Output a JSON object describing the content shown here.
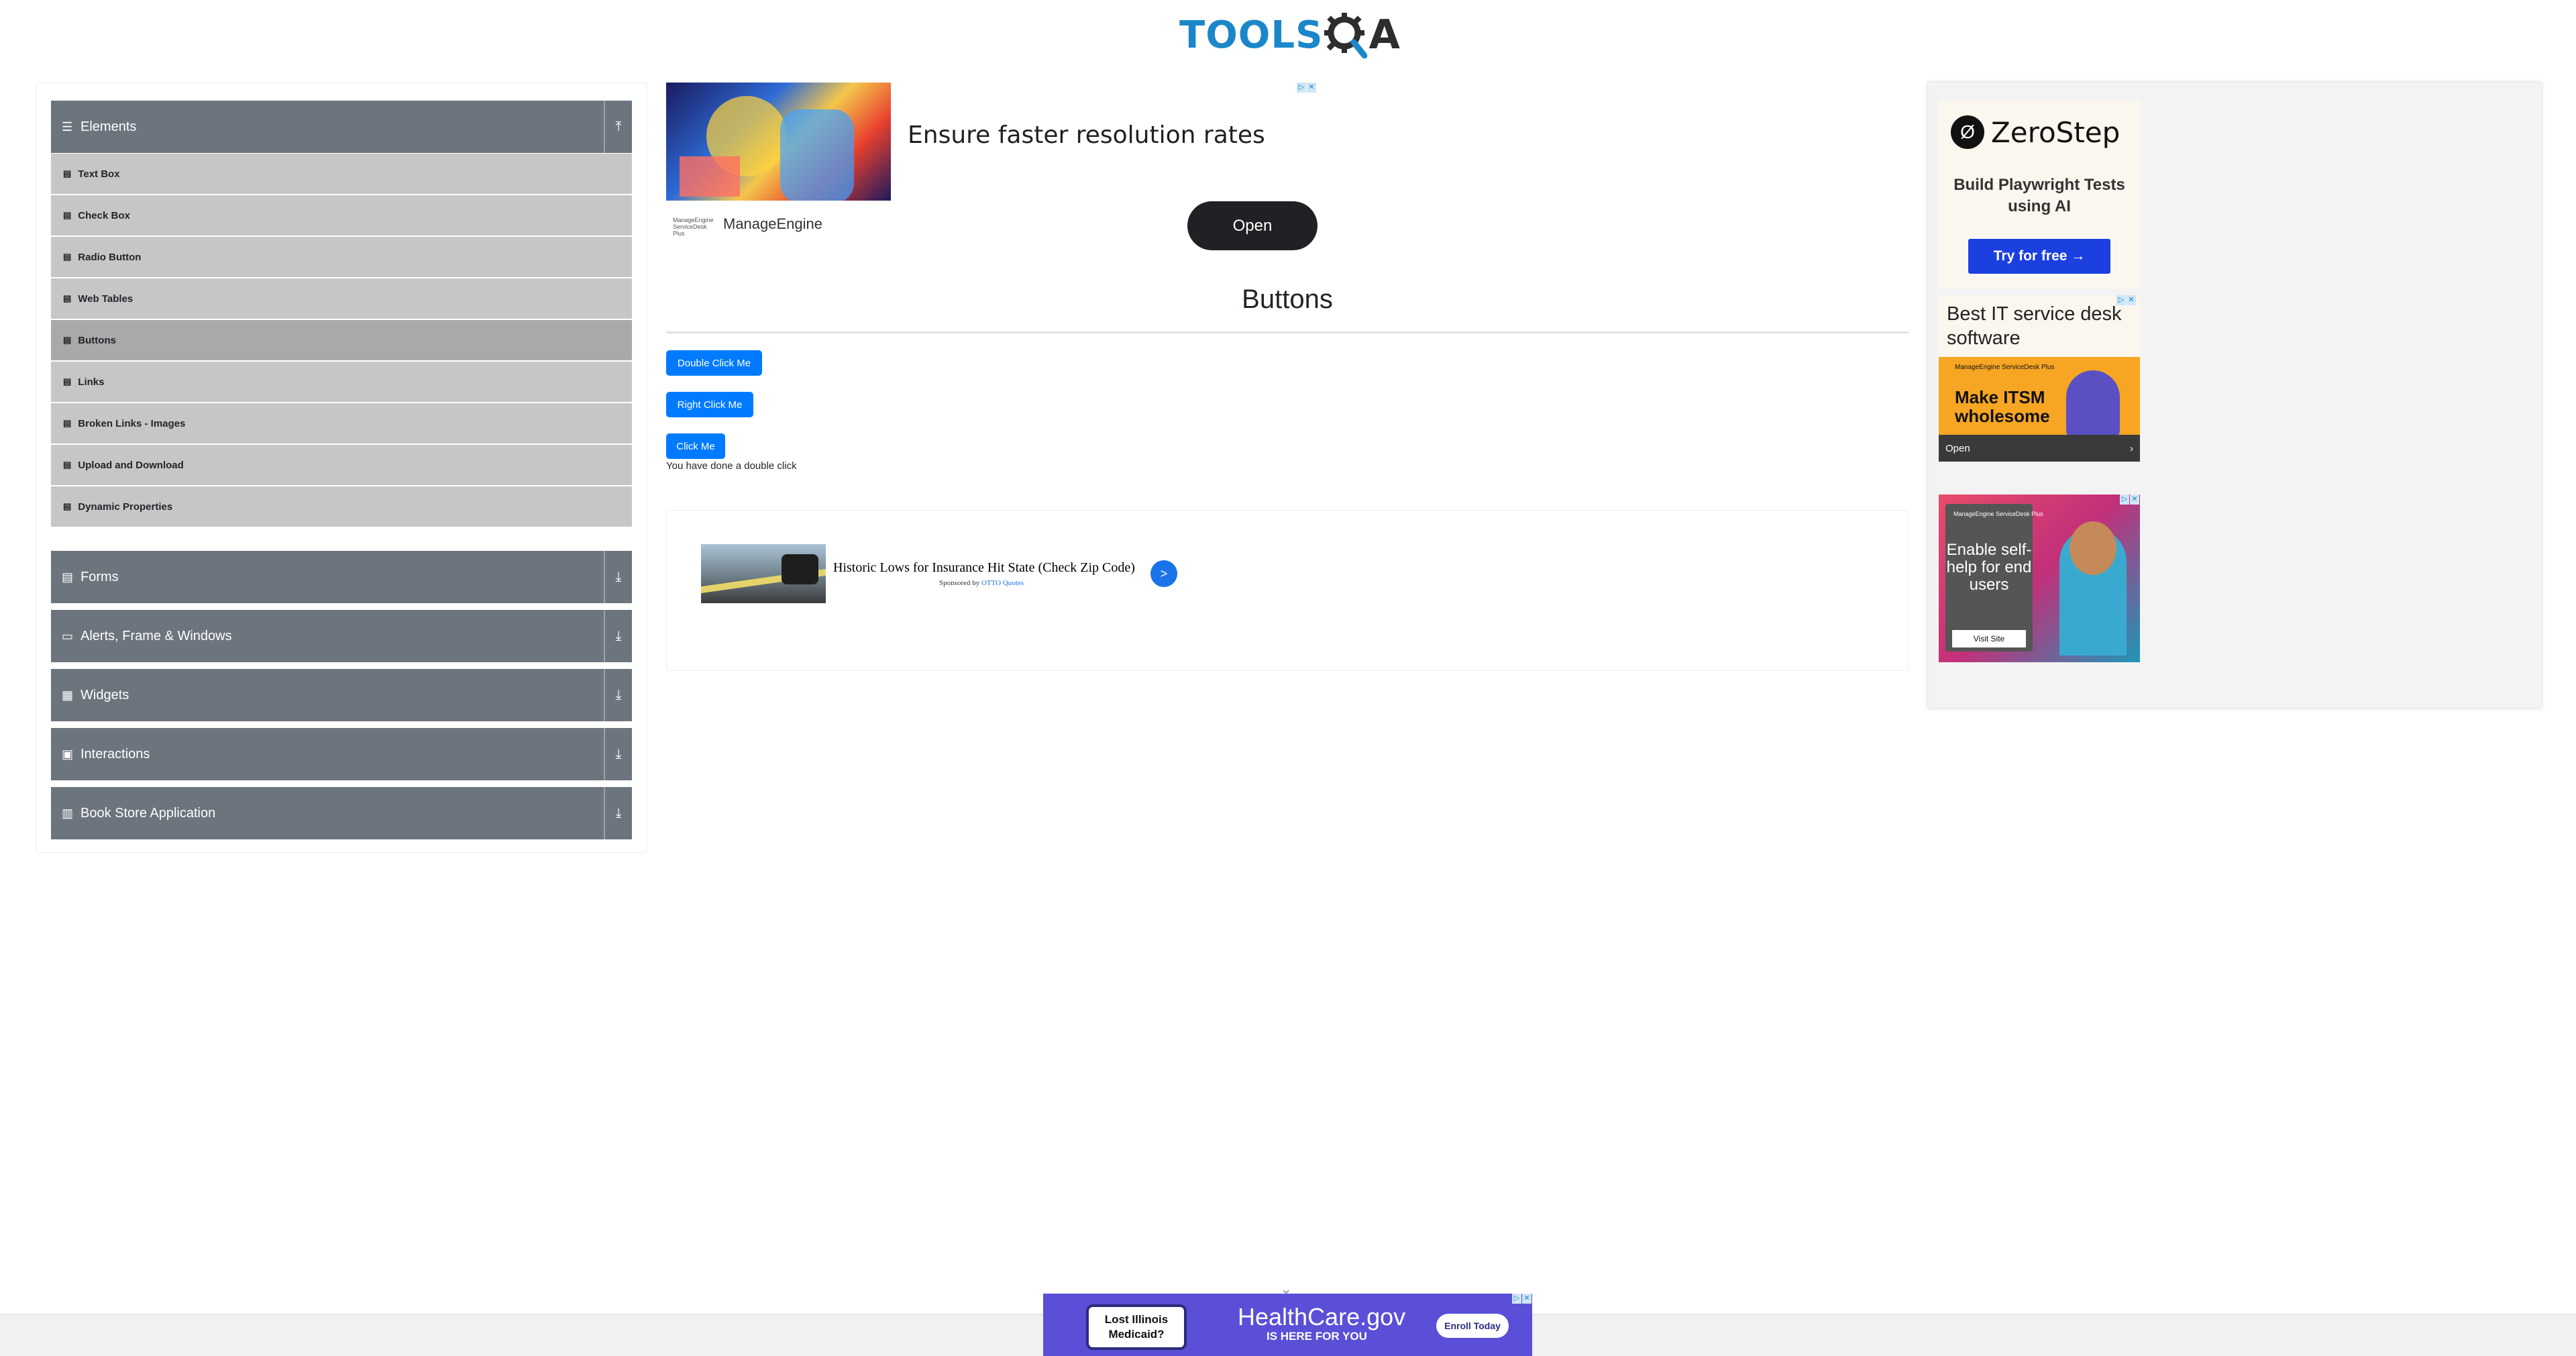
{
  "header": {
    "logo_text": "TOOLS",
    "logo_tail": "A"
  },
  "sidebar": {
    "elements_group": {
      "label": "Elements",
      "expanded": true
    },
    "items": [
      {
        "label": "Text Box"
      },
      {
        "label": "Check Box"
      },
      {
        "label": "Radio Button"
      },
      {
        "label": "Web Tables"
      },
      {
        "label": "Buttons",
        "active": true
      },
      {
        "label": "Links"
      },
      {
        "label": "Broken Links - Images"
      },
      {
        "label": "Upload and Download"
      },
      {
        "label": "Dynamic Properties"
      }
    ],
    "groups": [
      {
        "label": "Forms",
        "icon": "file-icon"
      },
      {
        "label": "Alerts, Frame & Windows",
        "icon": "window-icon"
      },
      {
        "label": "Widgets",
        "icon": "grid-icon"
      },
      {
        "label": "Interactions",
        "icon": "hand-icon"
      },
      {
        "label": "Book Store Application",
        "icon": "book-icon"
      }
    ]
  },
  "top_ad": {
    "headline": "Ensure faster resolution rates",
    "brand_logo": "ManageEngine ServiceDesk Plus",
    "brand": "ManageEngine",
    "cta": "Open"
  },
  "main": {
    "title": "Buttons",
    "buttons": {
      "double_click": "Double Click Me",
      "right_click": "Right Click Me",
      "click": "Click Me"
    },
    "message": "You have done a double click"
  },
  "inline_ad": {
    "title": "Historic Lows for Insurance Hit State (Check Zip Code)",
    "sponsored_prefix": "Sponsored by",
    "sponsor": "OTTO Quotes",
    "go": ">"
  },
  "right_ads": {
    "zerostep": {
      "name": "ZeroStep",
      "tagline": "Build Playwright Tests using AI",
      "cta": "Try for free →"
    },
    "manageengine": {
      "headline": "Best IT service desk software",
      "brand": "ManageEngine ServiceDesk Plus",
      "title": "Make ITSM wholesome",
      "cta": "Open"
    },
    "selfhelp": {
      "brand": "ManageEngine ServiceDesk Plus",
      "text": "Enable self-help for end users",
      "cta": "Visit Site"
    }
  },
  "bottom_ad": {
    "badge": "Lost Illinois Medicaid?",
    "brand": "HealthCare.gov",
    "sub": "IS HERE FOR YOU",
    "cta": "Enroll Today"
  },
  "colors": {
    "primary": "#007bff",
    "sidebar_header": "#6c757d",
    "sidebar_item": "#c6c6c6",
    "sidebar_active": "#a9a9a9",
    "logo_blue": "#1b87c9"
  }
}
